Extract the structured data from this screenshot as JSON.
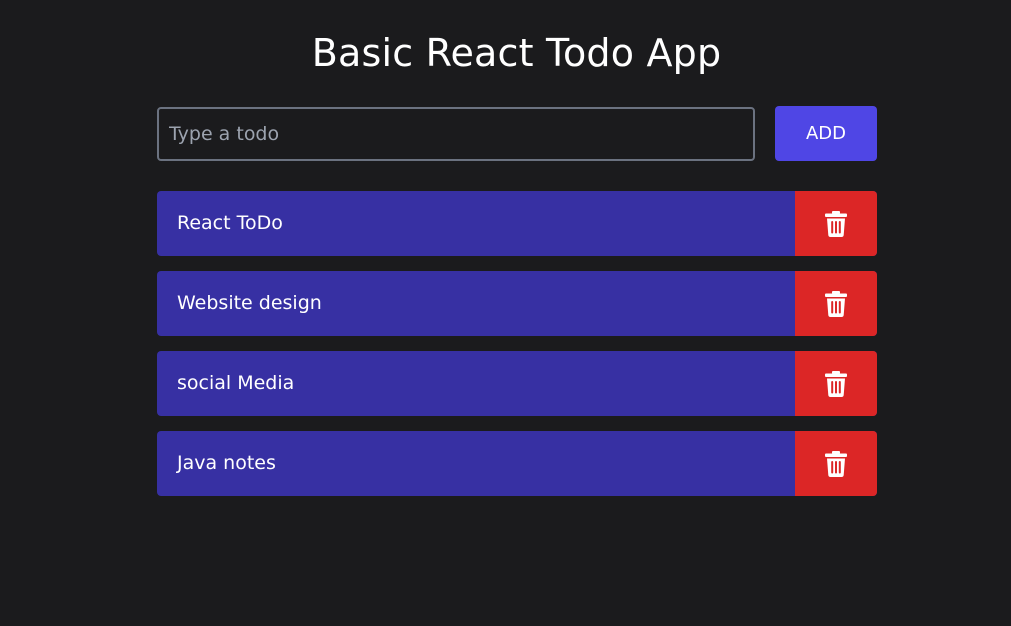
{
  "header": {
    "title": "Basic React Todo App"
  },
  "form": {
    "input_value": "",
    "input_placeholder": "Type a todo",
    "add_label": "ADD"
  },
  "todos": [
    {
      "text": "React ToDo",
      "delete_icon": "trash-icon"
    },
    {
      "text": "Website design",
      "delete_icon": "trash-icon"
    },
    {
      "text": "social Media",
      "delete_icon": "trash-icon"
    },
    {
      "text": "Java notes",
      "delete_icon": "trash-icon"
    }
  ],
  "colors": {
    "background": "#1b1b1d",
    "add_button": "#4f46e5",
    "todo_item": "#3730a3",
    "delete_button": "#dc2626",
    "input_border": "#6b7280",
    "text": "#ffffff"
  }
}
